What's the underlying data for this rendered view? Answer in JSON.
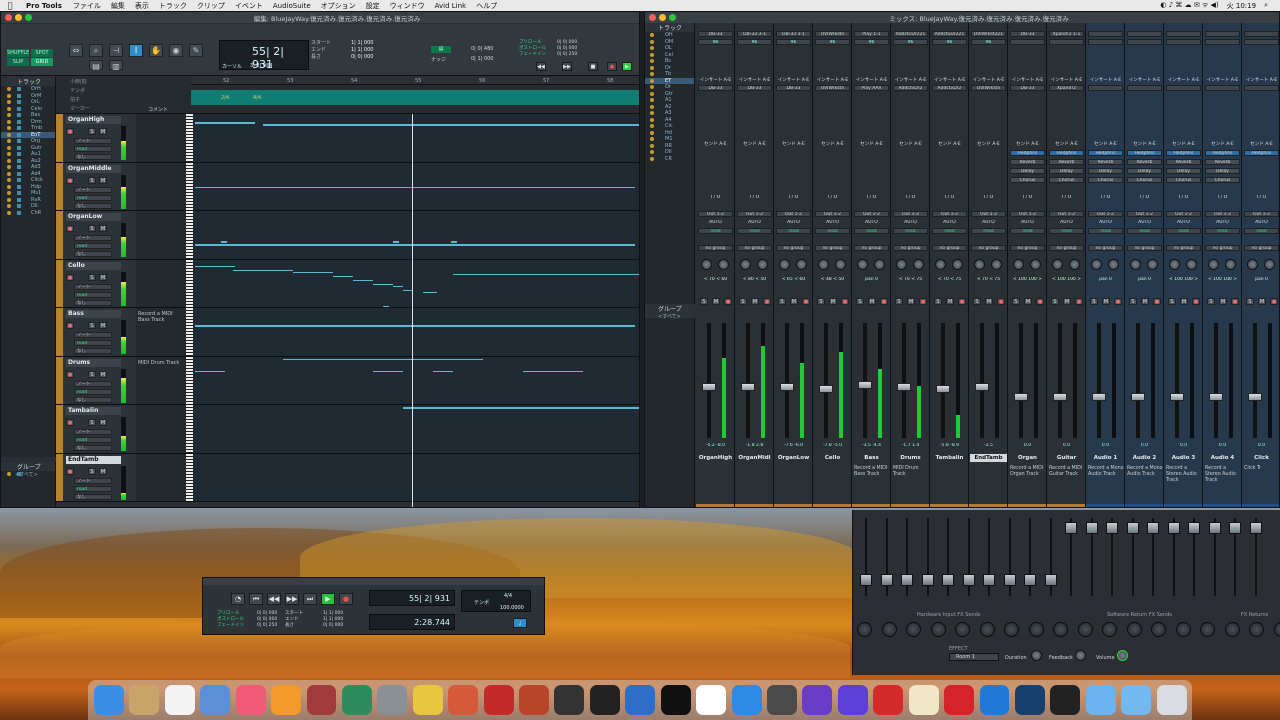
{
  "menubar": {
    "app": "Pro Tools",
    "items": [
      "ファイル",
      "編集",
      "表示",
      "トラック",
      "クリップ",
      "イベント",
      "AudioSuite",
      "オプション",
      "設定",
      "ウィンドウ",
      "Avid Link",
      "ヘルプ"
    ],
    "clock": "火 10:19"
  },
  "edit_window": {
    "title": "編集: BlueJayWay.復元済み.復元済み.復元済み.復元済み",
    "modes": [
      "SHUFFLE",
      "SPOT",
      "SLIP",
      "GRID"
    ],
    "main_counter": "55| 2| 931",
    "cursor_label": "カーソル",
    "cursor_value": "3| 2| 084",
    "start_label": "スタート",
    "end_label": "エンド",
    "length_label": "長さ",
    "start_value": "1| 1| 000",
    "end_value": "1| 1| 000",
    "length_value": "0| 0| 000",
    "grid_value": "0| 0| 480",
    "nudge_label": "ナッジ",
    "nudge_value": "0| 1| 000",
    "preroll_label": "プリロール",
    "postroll_label": "ポストロール",
    "fade_label": "フェードイン",
    "preroll_value": "0| 0| 000",
    "postroll_value": "0| 0| 000",
    "fade_value": "0| 0| 250",
    "track_list_header": "トラック",
    "track_list": [
      "OrH",
      "OrM",
      "OrL",
      "Celo",
      "Bas",
      "Drm",
      "Tmb",
      "EnT",
      "Org",
      "Gutr",
      "Au1",
      "Au2",
      "Ad3",
      "Ad4",
      "Click",
      "Hdp",
      "Ms1",
      "RvR",
      "Dll",
      "ChR"
    ],
    "selected_track_list": "EnT",
    "groups_header": "グループ",
    "groups_item": "<すべて>",
    "ruler_labels": [
      "小節|拍",
      "テンポ",
      "拍子",
      "マーカー"
    ],
    "bar_numbers": [
      "52",
      "53",
      "54",
      "55",
      "56",
      "57",
      "58"
    ],
    "markers": [
      "2/4",
      "4/4"
    ],
    "comment_header": "コメント",
    "footer_label": "再生"
  },
  "tracks": [
    {
      "name": "OrganHigh",
      "comment": "",
      "meter": 0.55,
      "selected": false
    },
    {
      "name": "OrganMiddle",
      "comment": "",
      "meter": 0.62,
      "selected": false
    },
    {
      "name": "OrganLow",
      "comment": "",
      "meter": 0.6,
      "selected": false
    },
    {
      "name": "Cello",
      "comment": "",
      "meter": 0.7,
      "selected": false
    },
    {
      "name": "Bass",
      "comment": "Record a MIDI Bass Track",
      "meter": 0.5,
      "selected": false
    },
    {
      "name": "Drums",
      "comment": "MIDI Drum Track",
      "meter": 0.72,
      "selected": false
    },
    {
      "name": "Tambalin",
      "comment": "",
      "meter": 0.45,
      "selected": false
    },
    {
      "name": "EndTamb",
      "comment": "",
      "meter": 0.2,
      "selected": true
    }
  ],
  "track_controls": {
    "s": "S",
    "m": "M",
    "rec": "●",
    "note": "ノート",
    "read": "read",
    "none": "なし"
  },
  "mix_window": {
    "title": "ミックス: BlueJayWay.復元済み.復元済み.復元済み.復元済み",
    "list_header": "トラック",
    "list": [
      "OH",
      "OM",
      "OL",
      "Cel",
      "Bs",
      "Dr",
      "Tb",
      "ET",
      "Or",
      "Gtr",
      "A1",
      "A2",
      "A3",
      "A4",
      "Clc",
      "Hd",
      "M1",
      "RR",
      "Dll",
      "CR"
    ],
    "selected": "ET",
    "group_header": "グループ",
    "group_item": "<すべて>",
    "inserts_label": "インサート A-E",
    "sends_label": "センド A-E",
    "io_label": "I / O",
    "auto_label": "AUTO",
    "group_btn": "no group",
    "pan_label": "pan"
  },
  "mix_strips": [
    {
      "name": "OrganHigh",
      "instr": "DB-33",
      "vol": "96",
      "insert": "DB-33",
      "out": "Out 1-2",
      "pan": "< 70  < 60",
      "comment": "",
      "fader": 0.4,
      "meter": 0.7,
      "blue": false,
      "sel": false,
      "sends": [],
      "in_meters": "-5.2 -8.0"
    },
    {
      "name": "OrganMidl",
      "instr": "DB-33 3-1",
      "vol": "96",
      "insert": "DB-33",
      "out": "Out 1-2",
      "pan": "< 80  < 50",
      "comment": "",
      "fader": 0.4,
      "meter": 0.8,
      "blue": false,
      "sel": false,
      "sends": [],
      "in_meters": "-1.8  2.8"
    },
    {
      "name": "OrganLow",
      "instr": "DB-33 3-1",
      "vol": "96",
      "insert": "DB-33",
      "out": "Out 1-2",
      "pan": "< 65  < 60",
      "comment": "",
      "fader": 0.4,
      "meter": 0.65,
      "blue": false,
      "sel": false,
      "sends": [],
      "in_meters": "-7.6 -6.0"
    },
    {
      "name": "Cello",
      "instr": "UVIWrkstn",
      "vol": "96",
      "insert": "UVIWrkstn",
      "out": "Out 1-2",
      "pan": "< 48  < 50",
      "comment": "",
      "fader": 0.38,
      "meter": 0.75,
      "blue": false,
      "sel": false,
      "sends": [],
      "in_meters": "-7.8 -5.0"
    },
    {
      "name": "Bass",
      "instr": "Play 1-1",
      "vol": "96",
      "insert": "Play AAX",
      "out": "Out 1-2",
      "pan": "pan 0",
      "comment": "Record a MIDI Bass Track",
      "fader": 0.42,
      "meter": 0.6,
      "blue": false,
      "sel": false,
      "sends": [],
      "in_meters": "-3.5 -4.4"
    },
    {
      "name": "Drums",
      "instr": "AddctvDr221",
      "vol": "96",
      "insert": "AddctvDr2",
      "out": "Out 1-2",
      "pan": "< 70  < 75",
      "comment": "MIDI Drum Track",
      "fader": 0.4,
      "meter": 0.45,
      "blue": false,
      "sel": false,
      "sends": [],
      "in_meters": "-1.7  1.4"
    },
    {
      "name": "Tambalin",
      "instr": "AddctvDr221",
      "vol": "96",
      "insert": "AddctvDr2",
      "out": "Out 1-2",
      "pan": "< 70  < 75",
      "comment": "",
      "fader": 0.38,
      "meter": 0.2,
      "blue": false,
      "sel": false,
      "sends": [],
      "in_meters": "-5.8 -8.9"
    },
    {
      "name": "EndTamb",
      "instr": "UVIWrkst221",
      "vol": "96",
      "insert": "UVIWrkstn",
      "out": "Out 1-2",
      "pan": "< 70  < 75",
      "comment": "",
      "fader": 0.4,
      "meter": 0.0,
      "blue": false,
      "sel": true,
      "sends": [],
      "in_meters": "-2.5"
    },
    {
      "name": "Organ",
      "instr": "DB-33",
      "vol": "",
      "insert": "DB-33",
      "out": "Out 1-2",
      "pan": "< 100  100 >",
      "comment": "Record a MIDI Organ Track",
      "fader": 0.3,
      "meter": 0.0,
      "blue": false,
      "sel": false,
      "sends": [
        "Hedphns",
        "Reverb",
        "Delay",
        "Chorus"
      ],
      "in_meters": "0.0"
    },
    {
      "name": "Guitar",
      "instr": "Xpand!2 1-1",
      "vol": "",
      "insert": "Xpand!2",
      "out": "Out 1-2",
      "pan": "< 100  100 >",
      "comment": "Record a MIDI Guitar Track",
      "fader": 0.3,
      "meter": 0.0,
      "blue": false,
      "sel": false,
      "sends": [
        "Hedphns",
        "Reverb",
        "Delay",
        "Chorus"
      ],
      "in_meters": "0.0"
    },
    {
      "name": "Audio 1",
      "instr": "",
      "vol": "",
      "insert": "",
      "out": "Out 1-2",
      "pan": "pan 0",
      "comment": "Record a Mono Audio Track",
      "fader": 0.3,
      "meter": 0.0,
      "blue": true,
      "sel": false,
      "sends": [
        "Hedphns",
        "Reverb",
        "Delay",
        "Chorus"
      ],
      "in_meters": "0.0"
    },
    {
      "name": "Audio 2",
      "instr": "",
      "vol": "",
      "insert": "",
      "out": "Out 1-2",
      "pan": "pan 0",
      "comment": "Record a Mono Audio Track",
      "fader": 0.3,
      "meter": 0.0,
      "blue": true,
      "sel": false,
      "sends": [
        "Hedphns",
        "Reverb",
        "Delay",
        "Chorus"
      ],
      "in_meters": "0.0"
    },
    {
      "name": "Audio 3",
      "instr": "",
      "vol": "",
      "insert": "",
      "out": "Out 1-2",
      "pan": "< 100  100 >",
      "comment": "Record a Stereo Audio Track",
      "fader": 0.3,
      "meter": 0.0,
      "blue": true,
      "sel": false,
      "sends": [
        "Hedphns",
        "Reverb",
        "Delay",
        "Chorus"
      ],
      "in_meters": "0.0"
    },
    {
      "name": "Audio 4",
      "instr": "",
      "vol": "",
      "insert": "",
      "out": "Out 1-2",
      "pan": "< 100  100 >",
      "comment": "Record a Stereo Audio Track",
      "fader": 0.3,
      "meter": 0.0,
      "blue": true,
      "sel": false,
      "sends": [
        "Hedphns",
        "Reverb",
        "Delay",
        "Chorus"
      ],
      "in_meters": "0.0"
    },
    {
      "name": "Click",
      "instr": "",
      "vol": "",
      "insert": "",
      "out": "Out 1-2",
      "pan": "pan 0",
      "comment": "Click Tr",
      "fader": 0.3,
      "meter": 0.0,
      "blue": true,
      "sel": false,
      "sends": [
        "Hedphns"
      ],
      "in_meters": "0.0"
    }
  ],
  "transport": {
    "counter": "55| 2| 931",
    "secondary": "2:28.744",
    "tempo_label": "テンポ",
    "tempo_value": "100.0000",
    "meter_value": "4/4",
    "preroll_value": "0| 0| 000",
    "postroll_value": "0| 0| 000",
    "fade_value": "0| 0| 250",
    "start_value": "1| 1| 000",
    "end_value": "1| 1| 000",
    "length_value": "0| 0| 000"
  },
  "control_surface": {
    "section1": "Hardware Input FX Sends",
    "section2": "Software Return FX Sends",
    "section3": "FX Returns",
    "effect_label": "EFFECT",
    "room_value": "Room 1",
    "duration_label": "Duration",
    "feedback_label": "Feedback",
    "volume_label": "Volume"
  },
  "dock": [
    "finder-icon",
    "notes-icon",
    "calendar-icon",
    "preview-icon",
    "music-icon",
    "books-icon",
    "photobooth-icon",
    "timemachine-icon",
    "syspref-icon",
    "photos-icon",
    "guitar-icon",
    "pod-farm-icon",
    "amp-icon",
    "mbox-icon",
    "piano-icon",
    "waveform-icon",
    "ilok-icon",
    "x-icon",
    "safari-icon",
    "avid-icon",
    "protools-icon",
    "avid2-icon",
    "eventide-icon",
    "rtas-icon",
    "ik-icon",
    "wave-icon",
    "link-icon",
    "waves-icon",
    "folder-icon",
    "apps-icon",
    "trash-icon"
  ]
}
